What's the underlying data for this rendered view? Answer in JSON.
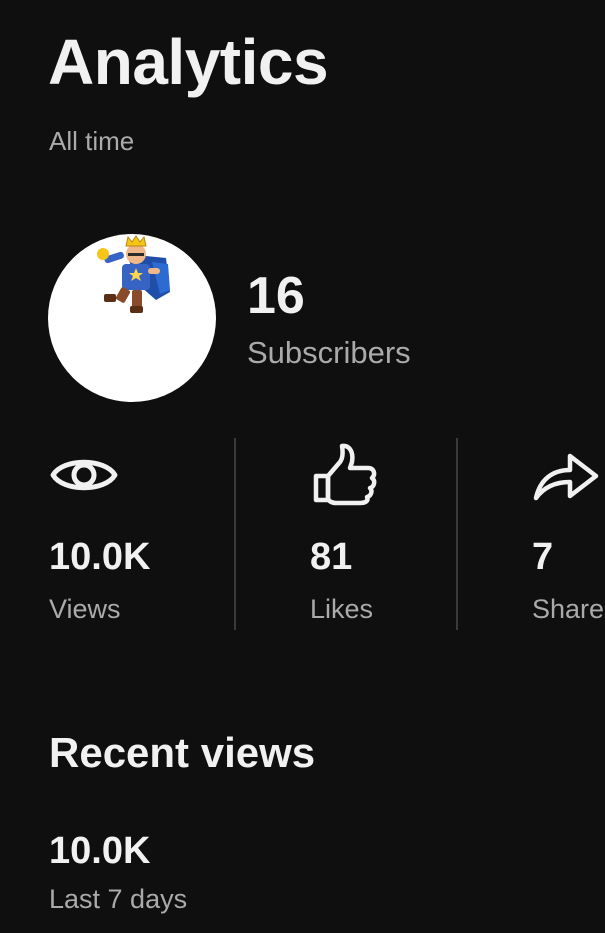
{
  "header": {
    "title": "Analytics",
    "period": "All time"
  },
  "channel": {
    "avatar_icon": "king-mascot-avatar",
    "subscriber_count": "16",
    "subscriber_label": "Subscribers"
  },
  "stats": [
    {
      "icon": "eye-icon",
      "value": "10.0K",
      "label": "Views"
    },
    {
      "icon": "thumbs-up-icon",
      "value": "81",
      "label": "Likes"
    },
    {
      "icon": "share-icon",
      "value": "7",
      "label": "Shares"
    }
  ],
  "recent": {
    "title": "Recent views",
    "value": "10.0K",
    "label": "Last 7 days"
  },
  "colors": {
    "background": "#0f0f0f",
    "text_primary": "#f1f1f1",
    "text_secondary": "#aaaaaa",
    "divider": "#3a3a3a"
  }
}
